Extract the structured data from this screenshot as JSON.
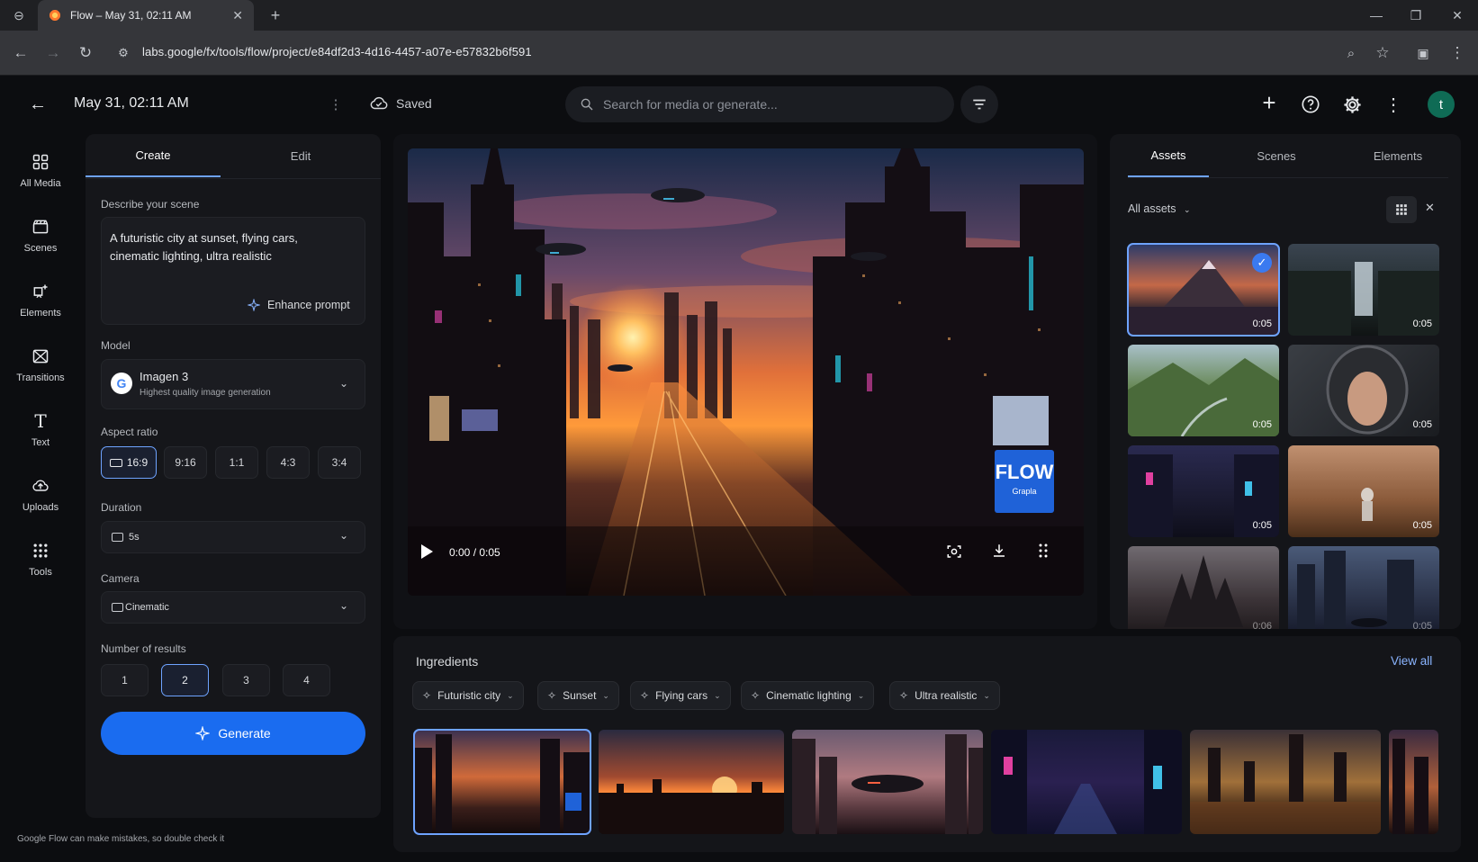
{
  "browser": {
    "tab_title": "Flow – May 31, 02:11 AM",
    "url": "labs.google/fx/tools/flow/project/e84df2d3-4d16-4457-a07e-e57832b6f591"
  },
  "header": {
    "title": "May 31, 02:11 AM",
    "saved_label": "Saved",
    "search_placeholder": "Search for media or generate...",
    "avatar_letter": "t"
  },
  "rail": [
    {
      "label": "All Media",
      "icon": "grid-icon"
    },
    {
      "label": "Scenes",
      "icon": "clapper-icon"
    },
    {
      "label": "Elements",
      "icon": "elements-icon"
    },
    {
      "label": "Transitions",
      "icon": "transitions-icon"
    },
    {
      "label": "Text",
      "icon": "text-icon"
    },
    {
      "label": "Uploads",
      "icon": "upload-icon"
    },
    {
      "label": "Tools",
      "icon": "tools-icon"
    }
  ],
  "create": {
    "tabs": [
      "Create",
      "Edit"
    ],
    "describe_label": "Describe your scene",
    "prompt_line1": "A futuristic city at sunset, flying cars,",
    "prompt_line2": "cinematic lighting, ultra realistic",
    "enhance_label": "Enhance prompt",
    "model_label": "Model",
    "model_name": "Imagen 3",
    "model_desc": "Highest quality image generation",
    "aspect_label": "Aspect ratio",
    "aspect_options": [
      "16:9",
      "9:16",
      "1:1",
      "4:3",
      "3:4"
    ],
    "aspect_selected": "16:9",
    "duration_label": "Duration",
    "duration_value": "5s",
    "camera_label": "Camera",
    "camera_value": "Cinematic",
    "results_label": "Number of results",
    "results_options": [
      "1",
      "2",
      "3",
      "4"
    ],
    "results_selected": "2",
    "generate_label": "Generate"
  },
  "player": {
    "time": "0:00 / 0:05",
    "progress": 0,
    "billboard_text": "FLOW",
    "billboard_sub": "Grapla"
  },
  "assets": {
    "tabs": [
      "Assets",
      "Scenes",
      "Elements"
    ],
    "filter_label": "All assets",
    "items": [
      {
        "duration": "0:05",
        "selected": true
      },
      {
        "duration": "0:05"
      },
      {
        "duration": "0:05"
      },
      {
        "duration": "0:05"
      },
      {
        "duration": "0:05"
      },
      {
        "duration": "0:05"
      },
      {
        "duration": "0:06"
      },
      {
        "duration": "0:05"
      }
    ]
  },
  "ingredients": {
    "title": "Ingredients",
    "view_all": "View all",
    "chips": [
      "Futuristic city",
      "Sunset",
      "Flying cars",
      "Cinematic lighting",
      "Ultra realistic"
    ]
  },
  "footer": {
    "disclaimer": "Google Flow can make mistakes, so double check it"
  },
  "colors": {
    "accent": "#1a6cf0",
    "selection": "#6ea3ff"
  }
}
